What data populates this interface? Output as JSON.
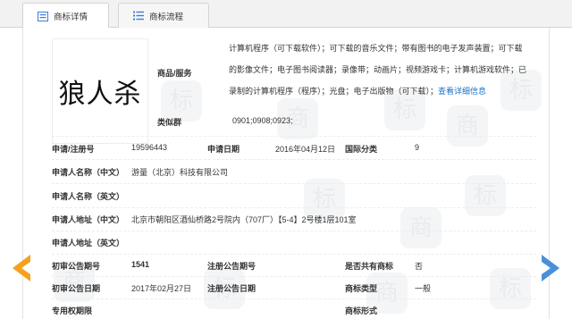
{
  "tabs": [
    {
      "label": "商标详情",
      "icon": "detail-list-icon"
    },
    {
      "label": "商标流程",
      "icon": "flow-list-icon"
    }
  ],
  "logo": {
    "text": "狼人杀"
  },
  "goods_services": {
    "label": "商品/服务",
    "text": "计算机程序（可下载软件）；可下载的音乐文件；带有图书的电子发声装置；可下载的影像文件；电子图书阅读器；录像带；动画片；视频游戏卡；计算机游戏软件；已录制的计算机程序（程序）；光盘；电子出版物（可下载）；",
    "link": "查看详细信息"
  },
  "similar_group": {
    "label": "类似群",
    "value": "0901;0908;0923;"
  },
  "fields": {
    "reg_no_label": "申请/注册号",
    "reg_no": "19596443",
    "apply_date_label": "申请日期",
    "apply_date": "2016年04月12日",
    "intl_class_label": "国际分类",
    "intl_class": "9",
    "applicant_cn_label": "申请人名称（中文）",
    "applicant_cn": "游量（北京）科技有限公司",
    "applicant_en_label": "申请人名称（英文）",
    "address_cn_label": "申请人地址（中文）",
    "address_cn": "北京市朝阳区酒仙桥路2号院内（707厂）【5-4】2号楼1层101室",
    "address_en_label": "申请人地址（英文）",
    "prelim_no_label": "初审公告期号",
    "prelim_no": "1541",
    "reg_pub_no_label": "注册公告期号",
    "shared_label": "是否共有商标",
    "shared": "否",
    "prelim_date_label": "初审公告日期",
    "prelim_date": "2017年02月27日",
    "reg_pub_date_label": "注册公告日期",
    "type_label": "商标类型",
    "type": "一般",
    "term_label": "专用权期限",
    "form_label": "商标形式"
  },
  "colors": {
    "arrow_left": "#f5a01f",
    "arrow_right": "#4a90d9",
    "link": "#1a73c9"
  }
}
